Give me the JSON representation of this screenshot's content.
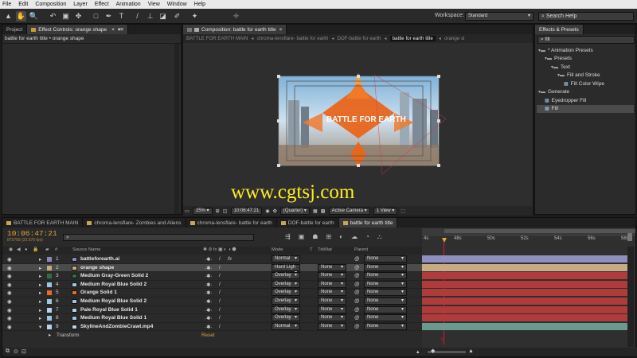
{
  "menu": [
    "File",
    "Edit",
    "Composition",
    "Layer",
    "Effect",
    "Animation",
    "View",
    "Window",
    "Help"
  ],
  "workspace": {
    "label": "Workspace:",
    "value": "Standard"
  },
  "search_help": {
    "placeholder": "Search Help"
  },
  "project_panel": {
    "tab": "Project",
    "effect_tab": "Effect Controls: orange shape",
    "breadcrumb": "battle for earth title • orange shape"
  },
  "comp_panel": {
    "tab": "Composition: battle for earth title",
    "crumbs": [
      "BATTLE FOR EARTH MAIN",
      "chroma-lensflare- battle for earth",
      "DOF-battle for earth",
      "battle for earth title",
      "orange sl"
    ],
    "zoom": "25%",
    "timecode": "10:06:47:21",
    "resolution": "(Quarter)",
    "camera": "Active Camera",
    "view": "1 View"
  },
  "effects_panel": {
    "tab": "Effects & Presets",
    "search": "fill",
    "tree": [
      {
        "label": "* Animation Presets",
        "level": 0,
        "type": "folder"
      },
      {
        "label": "Presets",
        "level": 1,
        "type": "folder"
      },
      {
        "label": "Text",
        "level": 2,
        "type": "folder"
      },
      {
        "label": "Fill and Stroke",
        "level": 3,
        "type": "folder"
      },
      {
        "label": "Fill Color Wipe",
        "level": 4,
        "type": "item"
      },
      {
        "label": "Generate",
        "level": 0,
        "type": "folder"
      },
      {
        "label": "Eyedropper Fill",
        "level": 1,
        "type": "item"
      },
      {
        "label": "Fill",
        "level": 1,
        "type": "item"
      }
    ]
  },
  "watermark": "www.cgtsj.com",
  "comp_text": "BATTLE FOR EARTH",
  "timeline": {
    "tabs": [
      "BATTLE FOR EARTH MAIN",
      "chroma-lensflare- Zombies and Aliens",
      "chroma-lensflare- battle for earth",
      "DOF-battle for earth",
      "battle for earth title"
    ],
    "timecode": "10:06:47:21",
    "fps": "873759 (23.976 fps)",
    "columns": {
      "num": "#",
      "source": "Source Name",
      "mode": "Mode",
      "t": "T",
      "trkmat": "TrkMat",
      "parent": "Parent"
    },
    "ruler": [
      "4s",
      "48s",
      "50s",
      "52s",
      "54s",
      "56s",
      "58s"
    ],
    "layers": [
      {
        "num": "1",
        "name": "battleforearth.ai",
        "color": "#8b86c2",
        "mode": "Normal",
        "trkmat": "",
        "parent": "None",
        "fx": true,
        "bar": "#8d8fc1"
      },
      {
        "num": "2",
        "name": "orange shape",
        "color": "#c8a97f",
        "mode": "Hard Ligh",
        "trkmat": "None",
        "parent": "None",
        "fx": false,
        "bar": "#c8ab82"
      },
      {
        "num": "3",
        "name": "Medium Gray-Green Solid 2",
        "color": "#2f6f48",
        "mode": "Overlay",
        "trkmat": "None",
        "parent": "None",
        "fx": false,
        "bar": "#b03b3b"
      },
      {
        "num": "4",
        "name": "Medium Royal Blue Solid 2",
        "color": "#9dc5e6",
        "mode": "Overlay",
        "trkmat": "None",
        "parent": "None",
        "fx": false,
        "bar": "#b03b3b"
      },
      {
        "num": "5",
        "name": "Orange Solid 1",
        "color": "#ee6a1f",
        "mode": "Overlay",
        "trkmat": "None",
        "parent": "None",
        "fx": false,
        "bar": "#b03b3b"
      },
      {
        "num": "6",
        "name": "Medium Royal Blue Solid 2",
        "color": "#9dc5e6",
        "mode": "Overlay",
        "trkmat": "None",
        "parent": "None",
        "fx": false,
        "bar": "#b03b3b"
      },
      {
        "num": "7",
        "name": "Pale Royal Blue Solid 1",
        "color": "#b9d2ea",
        "mode": "Overlay",
        "trkmat": "None",
        "parent": "None",
        "fx": false,
        "bar": "#b03b3b"
      },
      {
        "num": "8",
        "name": "Medium Royal Blue Solid 1",
        "color": "#9dc5e6",
        "mode": "Overlay",
        "trkmat": "None",
        "parent": "None",
        "fx": false,
        "bar": "#b03b3b"
      },
      {
        "num": "9",
        "name": "SkylineAndZombieCrawl.mp4",
        "color": "#b9d2ea",
        "mode": "Normal",
        "trkmat": "None",
        "parent": "None",
        "fx": false,
        "bar": "#6a9a8e"
      }
    ],
    "transform": {
      "label": "Transform",
      "reset": "Reset"
    }
  },
  "colors": {
    "accent": "#e8a33a",
    "selection": "#4b4b4b"
  }
}
